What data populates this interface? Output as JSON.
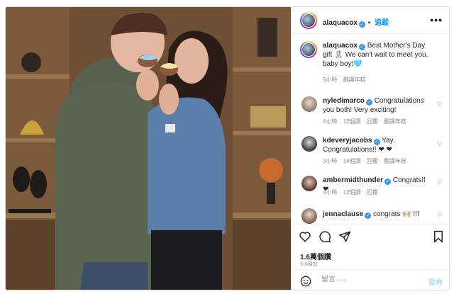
{
  "header": {
    "username": "alaquacox",
    "verified_mark": "✓",
    "separator": "•",
    "follow_label": "追蹤",
    "more_icon": "more-horizontal-icon"
  },
  "caption": {
    "username": "alaquacox",
    "text": "Best Mother's Day gift 🎗 We can't wait to meet you, baby boy!🩵",
    "time": "5小時",
    "translate_label": "翻譯年糕"
  },
  "comments": [
    {
      "username": "nyledimarco",
      "text": "Congratulations you both! Very exciting!",
      "time": "4小時",
      "likes": "12個讚",
      "reply": "回覆",
      "translate": "翻譯年糕"
    },
    {
      "username": "kdeveryjacobs",
      "text": "Yay. Congratulations!! ❤ ❤",
      "time": "3小時",
      "likes": "14個讚",
      "reply": "回覆",
      "translate": "翻譯年糕"
    },
    {
      "username": "ambermidthunder",
      "text": "Congrats!! ❤",
      "time": "4小時",
      "likes": "13個讚",
      "reply": "回覆",
      "translate": ""
    },
    {
      "username": "jennaclause",
      "text": "congrats 🙌🏼 !!!",
      "time": "",
      "likes": "",
      "reply": "",
      "translate": ""
    }
  ],
  "actions": {
    "like_icon": "heart-outline-icon",
    "comment_icon": "comment-bubble-icon",
    "share_icon": "paper-plane-icon",
    "save_icon": "bookmark-icon",
    "likes_count": "1.6萬個讚",
    "time_ago": "5小時前"
  },
  "add_comment": {
    "placeholder": "留言......",
    "post_label": "發佈"
  },
  "colors": {
    "accent": "#0095f6",
    "verified": "#3897f0",
    "heart_red": "#ed4956",
    "muted_text": "#8e8e8e"
  }
}
